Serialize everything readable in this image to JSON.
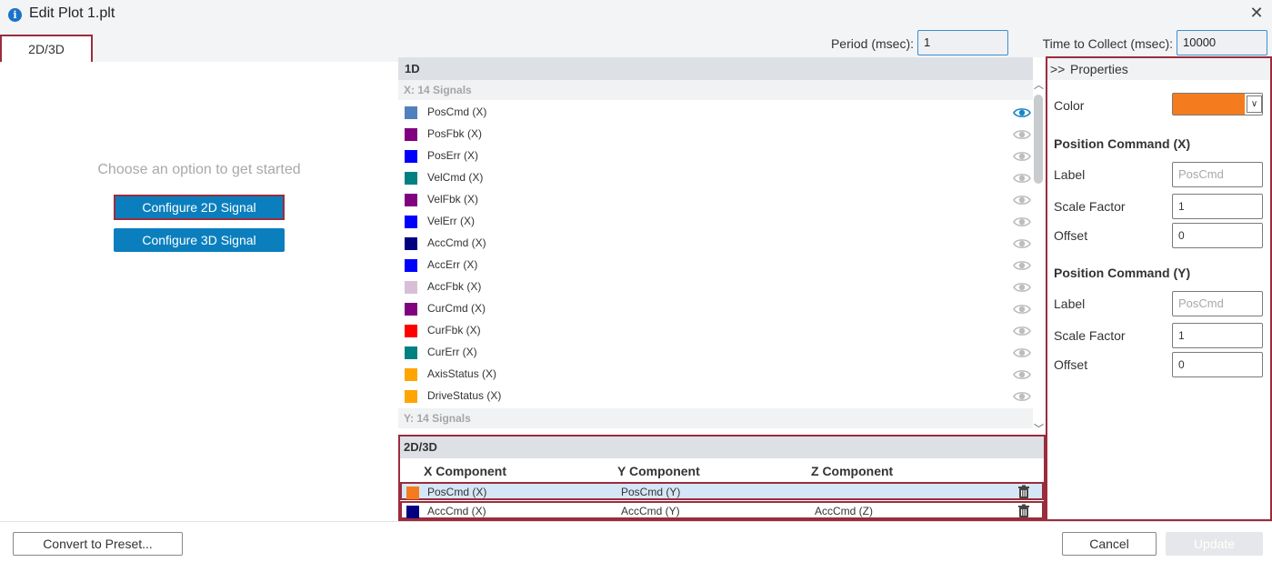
{
  "window": {
    "title": "Edit Plot 1.plt",
    "info_glyph": "i",
    "close_glyph": "✕"
  },
  "toolbar": {
    "tab_label": "2D/3D",
    "period_label": "Period (msec):",
    "period_value": "1",
    "ttc_label": "Time to Collect (msec):",
    "ttc_value": "10000"
  },
  "left": {
    "prompt": "Choose an option to get started",
    "btn_2d": "Configure 2D Signal",
    "btn_3d": "Configure 3D Signal"
  },
  "signals": {
    "header": "1D",
    "group_x": "X: 14 Signals",
    "group_y": "Y: 14 Signals",
    "items": [
      {
        "label": "PosCmd (X)",
        "color": "#4f81bd",
        "visible": true
      },
      {
        "label": "PosFbk (X)",
        "color": "#800080",
        "visible": false
      },
      {
        "label": "PosErr (X)",
        "color": "#0000ff",
        "visible": false
      },
      {
        "label": "VelCmd (X)",
        "color": "#008080",
        "visible": false
      },
      {
        "label": "VelFbk (X)",
        "color": "#800080",
        "visible": false
      },
      {
        "label": "VelErr (X)",
        "color": "#0000ff",
        "visible": false
      },
      {
        "label": "AccCmd (X)",
        "color": "#000080",
        "visible": false
      },
      {
        "label": "AccErr (X)",
        "color": "#0000ff",
        "visible": false
      },
      {
        "label": "AccFbk (X)",
        "color": "#d8bfd8",
        "visible": false
      },
      {
        "label": "CurCmd (X)",
        "color": "#800080",
        "visible": false
      },
      {
        "label": "CurFbk (X)",
        "color": "#ff0000",
        "visible": false
      },
      {
        "label": "CurErr (X)",
        "color": "#008080",
        "visible": false
      },
      {
        "label": "AxisStatus (X)",
        "color": "#ffa500",
        "visible": false
      },
      {
        "label": "DriveStatus (X)",
        "color": "#ffa500",
        "visible": false
      }
    ],
    "scroll_up": "︿",
    "scroll_down": "﹀"
  },
  "components": {
    "header": "2D/3D",
    "col_x": "X Component",
    "col_y": "Y Component",
    "col_z": "Z Component",
    "rows": [
      {
        "x": "PosCmd (X)",
        "y": "PosCmd (Y)",
        "z": "",
        "color": "#f47c1e"
      },
      {
        "x": "AccCmd (X)",
        "y": "AccCmd (Y)",
        "z": "AccCmd (Z)",
        "color": "#000080"
      }
    ]
  },
  "properties": {
    "chevron": ">>",
    "title": "Properties",
    "color_label": "Color",
    "color_value": "#f47c1e",
    "color_arrow": "∨",
    "section_x": "Position Command (X)",
    "section_y": "Position Command (Y)",
    "label_label": "Label",
    "scale_label": "Scale Factor",
    "offset_label": "Offset",
    "x_label_placeholder": "PosCmd",
    "x_scale": "1",
    "x_offset": "0",
    "y_label_placeholder": "PosCmd",
    "y_scale": "1",
    "y_offset": "0"
  },
  "footer": {
    "preset": "Convert to Preset...",
    "cancel": "Cancel",
    "update": "Update"
  }
}
